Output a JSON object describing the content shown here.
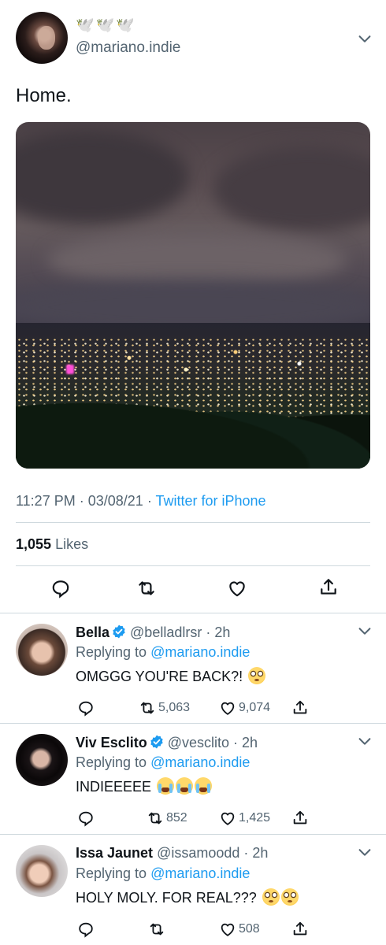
{
  "main_tweet": {
    "display_name": "🕊️🕊️🕊️",
    "handle": "@mariano.indie",
    "text": "Home.",
    "time": "11:27 PM",
    "date": "03/08/21",
    "source": "Twitter for iPhone",
    "likes_count": "1,055",
    "likes_label": "Likes"
  },
  "replies": [
    {
      "name": "Bella",
      "verified": true,
      "handle": "@belladlrsr",
      "age": "2h",
      "replying_prefix": "Replying to",
      "replying_to": "@mariano.indie",
      "text": "OMGGG YOU'RE BACK?!",
      "emoji": [
        "flushed"
      ],
      "retweets": "5,063",
      "likes": "9,074"
    },
    {
      "name": "Viv Esclito",
      "verified": true,
      "handle": "@vesclito",
      "age": "2h",
      "replying_prefix": "Replying to",
      "replying_to": "@mariano.indie",
      "text": "INDIEEEEE",
      "emoji": [
        "sob",
        "sob",
        "sob"
      ],
      "retweets": "852",
      "likes": "1,425"
    },
    {
      "name": "Issa Jaunet",
      "verified": false,
      "handle": "@issamoodd",
      "age": "2h",
      "replying_prefix": "Replying to",
      "replying_to": "@mariano.indie",
      "text": "HOLY MOLY. FOR REAL???",
      "emoji": [
        "flushed",
        "flushed"
      ],
      "retweets": "",
      "likes": "508"
    }
  ],
  "colors": {
    "link": "#1d9bf0",
    "secondary_text": "#536471",
    "divider": "#cfd9de"
  },
  "icons": [
    "chevron-down-icon",
    "reply-icon",
    "retweet-icon",
    "like-icon",
    "share-icon",
    "verified-badge-icon"
  ]
}
